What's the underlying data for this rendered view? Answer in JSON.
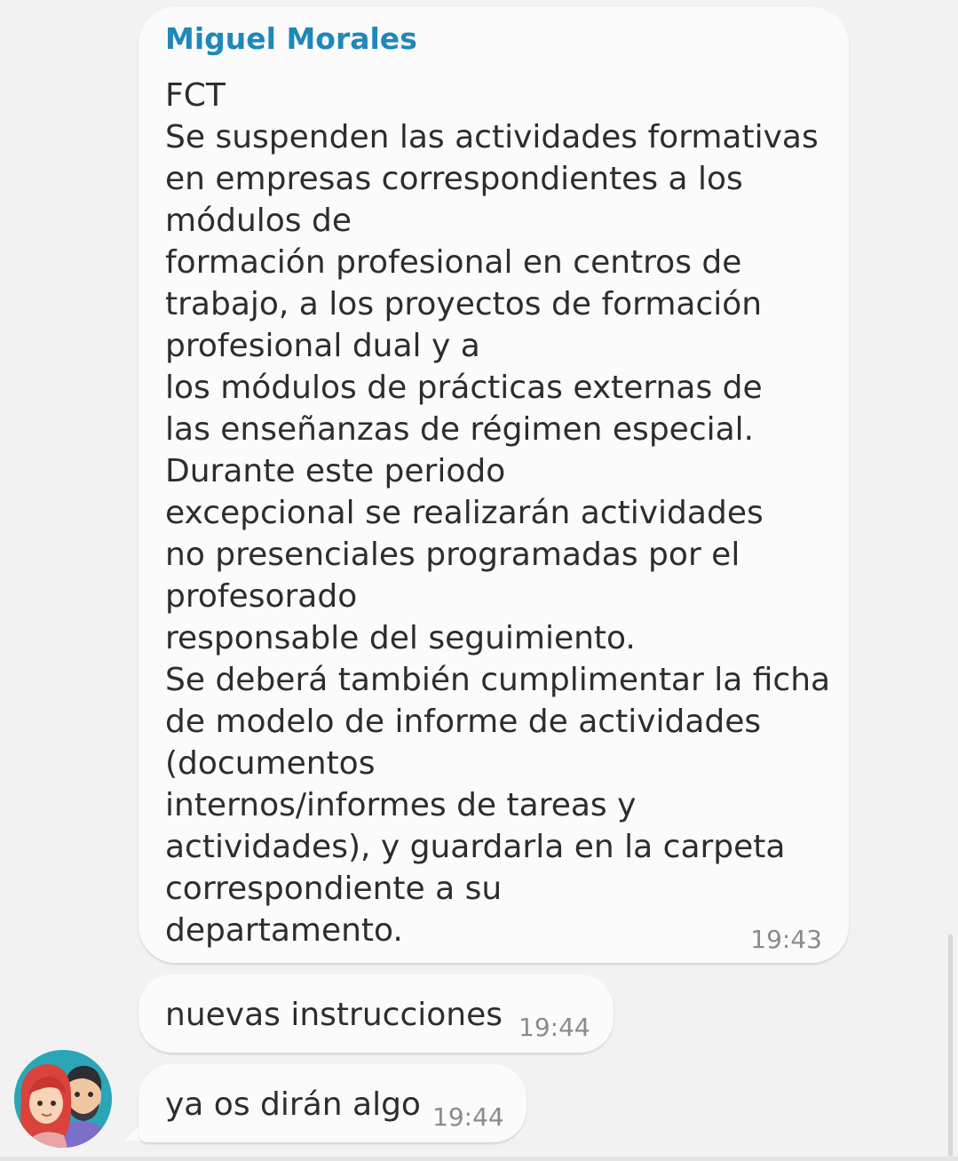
{
  "messages": [
    {
      "sender": "Miguel Morales",
      "text": "FCT\nSe suspenden las actividades formativas\nen empresas correspondientes a los\nmódulos de\nformación profesional en centros de\ntrabajo, a los proyectos de formación\nprofesional dual y a\nlos módulos de prácticas externas de\nlas enseñanzas de régimen especial.\nDurante este periodo\nexcepcional se realizarán actividades\nno presenciales programadas por el\nprofesorado\nresponsable del seguimiento.\nSe deberá también cumplimentar la ficha\nde modelo de informe de actividades\n(documentos\ninternos/informes de tareas y\nactividades), y guardarla en la carpeta\ncorrespondiente a su\ndepartamento.",
      "time": "19:43"
    },
    {
      "text": "nuevas instrucciones",
      "time": "19:44"
    },
    {
      "text": "ya os dirán algo",
      "time": "19:44"
    }
  ],
  "avatar_icon": "user-avatar-couple-illustration",
  "colors": {
    "background": "#f2f2f2",
    "bubble": "#fbfbfb",
    "sender_name": "#1e88b9",
    "text": "#2d2d2d",
    "timestamp": "#8b8b8b",
    "avatar_bg": "#2aa6b6"
  }
}
